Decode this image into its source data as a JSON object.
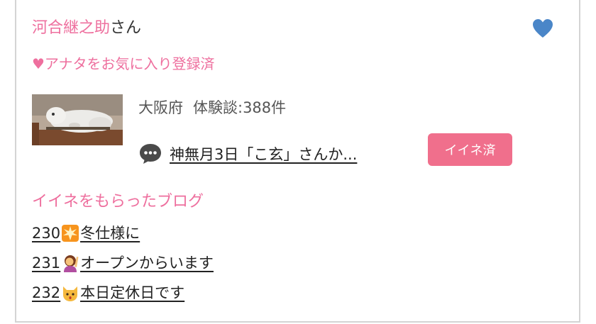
{
  "user": {
    "name": "河合継之助",
    "name_suffix": "さん",
    "favorite_status": "♥アナタをお気に入り登録済",
    "region": "大阪府",
    "review_count": "体験談:388件"
  },
  "latest_review": {
    "title": "神無月3日「こ玄」さんか...",
    "like_button": "イイネ済"
  },
  "liked_blogs": {
    "heading": "イイネをもらったブログ",
    "items": [
      {
        "number": "230",
        "emoji_icon": "sparkle-icon",
        "title": "冬仕様に"
      },
      {
        "number": "231",
        "emoji_icon": "raising-hand-icon",
        "title": "オープンからいます"
      },
      {
        "number": "232",
        "emoji_icon": "cat-face-icon",
        "title": "本日定休日です"
      }
    ]
  },
  "colors": {
    "accent_pink": "#ee6f9e",
    "button_pink": "#f06f8c",
    "heart_blue": "#4a86c8"
  }
}
